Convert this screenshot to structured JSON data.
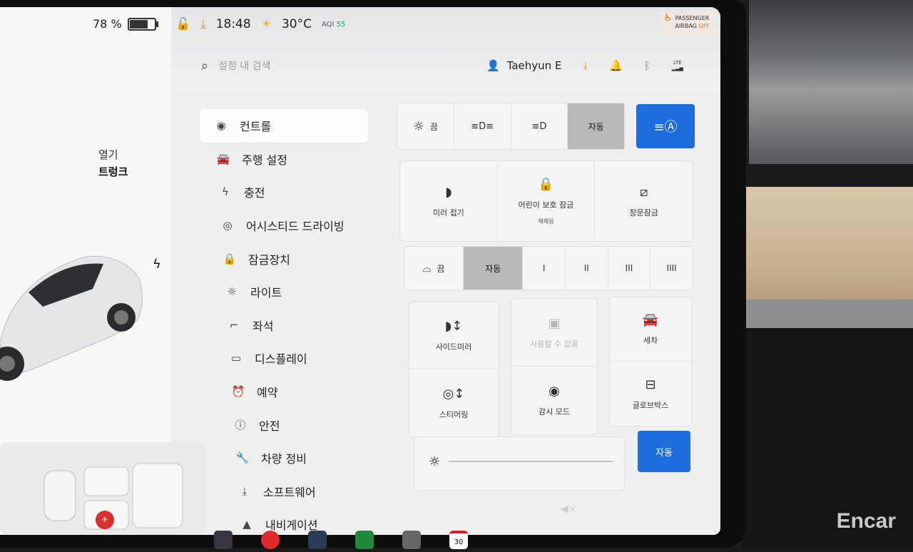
{
  "battery": {
    "percent_label": "78 %",
    "level": 0.78
  },
  "status": {
    "time": "18:48",
    "temperature": "30°C",
    "aqi_label": "AQI",
    "aqi_value": "55"
  },
  "airbag": {
    "line1": "PASSENGER",
    "line2": "AIRBAG",
    "state": "OFF"
  },
  "search": {
    "placeholder": "설정 내 검색"
  },
  "user": {
    "name": "Taehyun E"
  },
  "network": {
    "label": "LTE"
  },
  "car_panel": {
    "open_label": "열기",
    "trunk_label": "트렁크"
  },
  "menu": {
    "items": [
      {
        "label": "컨트롤",
        "icon": "toggle-icon",
        "glyph": "◉",
        "active": true
      },
      {
        "label": "주행 설정",
        "icon": "car-icon",
        "glyph": "🚘",
        "active": false
      },
      {
        "label": "충전",
        "icon": "bolt-icon",
        "glyph": "ϟ",
        "active": false
      },
      {
        "label": "어시스티드 드라이빙",
        "icon": "steering-wheel-icon",
        "glyph": "◎",
        "active": false
      },
      {
        "label": "잠금장치",
        "icon": "lock-icon",
        "glyph": "🔒",
        "active": false
      },
      {
        "label": "라이트",
        "icon": "sun-icon",
        "glyph": "☼",
        "active": false
      },
      {
        "label": "좌석",
        "icon": "seat-icon",
        "glyph": "⌐",
        "active": false
      },
      {
        "label": "디스플레이",
        "icon": "display-icon",
        "glyph": "▭",
        "active": false
      },
      {
        "label": "예약",
        "icon": "alarm-clock-icon",
        "glyph": "⏰",
        "active": false
      },
      {
        "label": "안전",
        "icon": "info-icon",
        "glyph": "ⓘ",
        "active": false
      },
      {
        "label": "차량 정비",
        "icon": "wrench-icon",
        "glyph": "🔧",
        "active": false
      },
      {
        "label": "소프트웨어",
        "icon": "download-icon",
        "glyph": "⤓",
        "active": false
      },
      {
        "label": "내비게이션",
        "icon": "navigation-icon",
        "glyph": "▲",
        "active": false
      }
    ]
  },
  "lights": {
    "off_label": "끔",
    "auto_label": "자동"
  },
  "tiles_row1": {
    "mirror_fold": "미러 접기",
    "child_lock": "어린이 보호 잠금",
    "child_lock_sub": "해제됨",
    "window_lock": "창문잠금"
  },
  "wipers": {
    "off_label": "끔",
    "auto_label": "자동",
    "speeds": [
      "I",
      "II",
      "III",
      "IIII"
    ]
  },
  "tiles_row2": {
    "side_mirror": "사이드미러",
    "unavailable": "사용할 수 없음",
    "car_wash": "세차",
    "steering": "스티어링",
    "sentry": "감시 모드",
    "glovebox": "글로브박스"
  },
  "brightness": {
    "auto_label": "자동"
  },
  "dock": {
    "calendar_day": "30"
  },
  "volume": {
    "label": "◀×"
  },
  "watermark": "Encar"
}
